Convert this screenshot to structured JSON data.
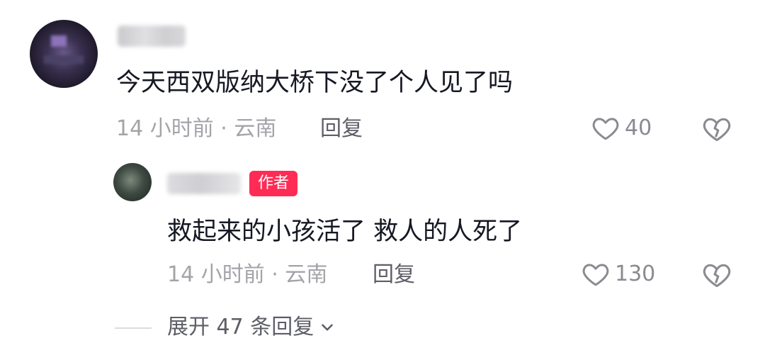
{
  "comment": {
    "text": "今天西双版纳大桥下没了个人见了吗",
    "time_location": "14 小时前 · 云南",
    "reply_label": "回复",
    "likes": "40",
    "avatar_icon": "user-avatar",
    "like_icon": "heart-outline-icon",
    "dislike_icon": "broken-heart-icon"
  },
  "reply": {
    "badge": "作者",
    "text": "救起来的小孩活了  救人的人死了",
    "time_location": "14 小时前 · 云南",
    "reply_label": "回复",
    "likes": "130",
    "avatar_icon": "user-avatar",
    "like_icon": "heart-outline-icon",
    "dislike_icon": "broken-heart-icon"
  },
  "expand": {
    "label": "展开 47 条回复",
    "icon": "chevron-down-icon"
  },
  "colors": {
    "badge_bg": "#fe2c55",
    "text_primary": "#161823",
    "text_meta": "#a3a4a8",
    "text_secondary": "#5d5e66"
  }
}
